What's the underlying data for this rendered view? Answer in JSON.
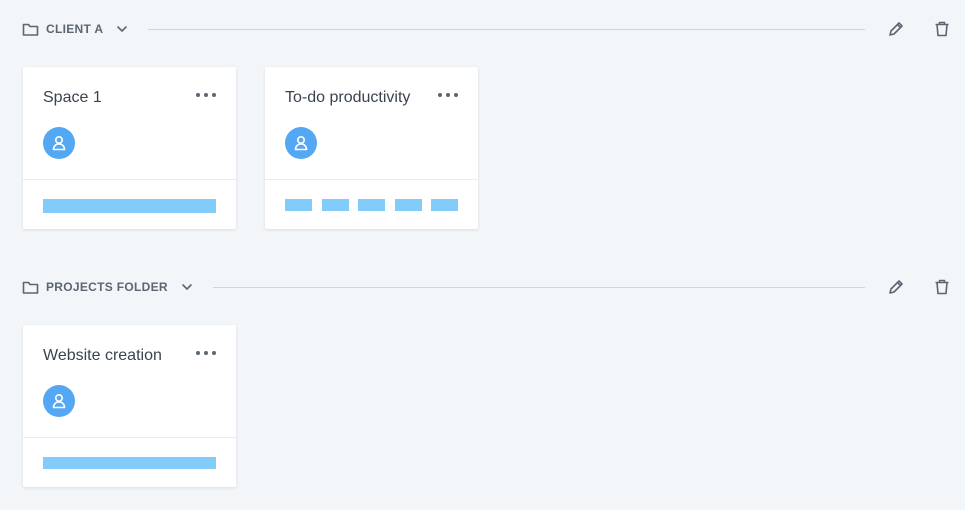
{
  "folders": [
    {
      "name": "CLIENT A",
      "cards": [
        {
          "title": "Space 1",
          "bar": "full"
        },
        {
          "title": "To-do productivity",
          "bar": "segments",
          "segments": 5
        }
      ]
    },
    {
      "name": "PROJECTS FOLDER",
      "cards": [
        {
          "title": "Website creation",
          "bar": "full"
        }
      ]
    }
  ],
  "colors": {
    "background": "#f3f6f9",
    "avatar": "#53a7f3",
    "progress": "#82ccfb",
    "icon": "#5c6673"
  },
  "icons": {
    "folder": "folder-icon",
    "chevron": "chevron-down-icon",
    "edit": "pencil-icon",
    "delete": "trash-icon",
    "more": "more-dots-icon",
    "avatar": "user-icon"
  }
}
